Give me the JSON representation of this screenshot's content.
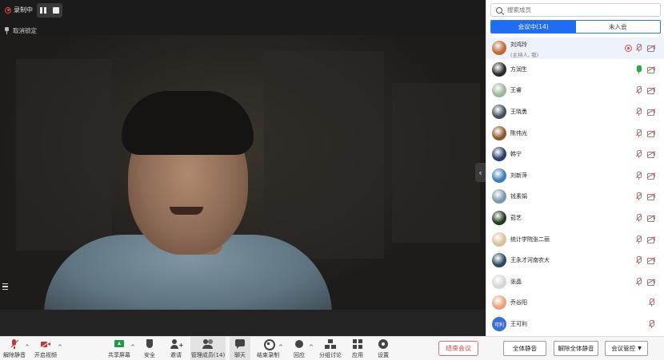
{
  "recording": {
    "label": "录制中"
  },
  "unpin": {
    "label": "取消锁定"
  },
  "sidebar": {
    "search_placeholder": "搜索成员",
    "tab_in_meeting": "会议中(14)",
    "tab_not_joined": "未入会"
  },
  "members": [
    {
      "name": "刘鸿玲",
      "sub": "(主持人, 我)",
      "recording": true,
      "mic": "muted",
      "camera": "off",
      "avatar_color": "#c0692e"
    },
    {
      "name": "方润生",
      "sub": "",
      "recording": false,
      "mic": "on",
      "camera": "off",
      "avatar_color": "#2b2b2b"
    },
    {
      "name": "王睿",
      "sub": "",
      "recording": false,
      "mic": "muted",
      "camera": "off",
      "avatar_color": "#9bb59a"
    },
    {
      "name": "王晓勇",
      "sub": "",
      "recording": false,
      "mic": "muted",
      "camera": "off",
      "avatar_color": "#444e5a"
    },
    {
      "name": "陈伟光",
      "sub": "",
      "recording": false,
      "mic": "muted",
      "camera": "off",
      "avatar_color": "#8a5a2a"
    },
    {
      "name": "韩宁",
      "sub": "",
      "recording": false,
      "mic": "muted",
      "camera": "off",
      "avatar_color": "#2a3e6b"
    },
    {
      "name": "刘新萍",
      "sub": "",
      "recording": false,
      "mic": "muted",
      "camera": "off",
      "avatar_color": "#3f7cb8"
    },
    {
      "name": "钱素娟",
      "sub": "",
      "recording": false,
      "mic": "muted",
      "camera": "off",
      "avatar_color": "#7a97a8"
    },
    {
      "name": "茹艺",
      "sub": "",
      "recording": false,
      "mic": "muted",
      "camera": "off",
      "avatar_color": "#233a1c"
    },
    {
      "name": "统计学院张二丽",
      "sub": "",
      "recording": false,
      "mic": "muted",
      "camera": "off",
      "avatar_color": "#d8c09a"
    },
    {
      "name": "王永才河南农大",
      "sub": "",
      "recording": false,
      "mic": "muted",
      "camera": "off",
      "avatar_color": "#2c4a5c"
    },
    {
      "name": "张晶",
      "sub": "",
      "recording": false,
      "mic": "muted",
      "camera": "off",
      "avatar_color": "#d6d6d6"
    },
    {
      "name": "乔谷阳",
      "sub": "",
      "recording": false,
      "mic": "muted",
      "camera": "none",
      "avatar_color": "#e8a27a"
    },
    {
      "name": "王可利",
      "sub": "",
      "recording": false,
      "mic": "muted",
      "camera": "none",
      "avatar_color": "#3a6fd8",
      "avatar_text": "可利"
    }
  ],
  "toolbar": {
    "unmute": "解除静音",
    "start_video": "开启视频",
    "share_screen": "共享屏幕",
    "security": "安全",
    "invite": "邀请",
    "manage_members": "管理成员(14)",
    "chat": "聊天",
    "stop_recording": "结束录制",
    "reactions": "回应",
    "breakout": "分组讨论",
    "apps": "应用",
    "settings": "设置",
    "end_meeting": "结束会议",
    "mute_all": "全体静音",
    "unmute_all": "解除全体静音",
    "meeting_control": "会议管控"
  },
  "colors": {
    "accent": "#1f6cf5",
    "danger": "#e04848",
    "mic_on": "#2aa847"
  }
}
